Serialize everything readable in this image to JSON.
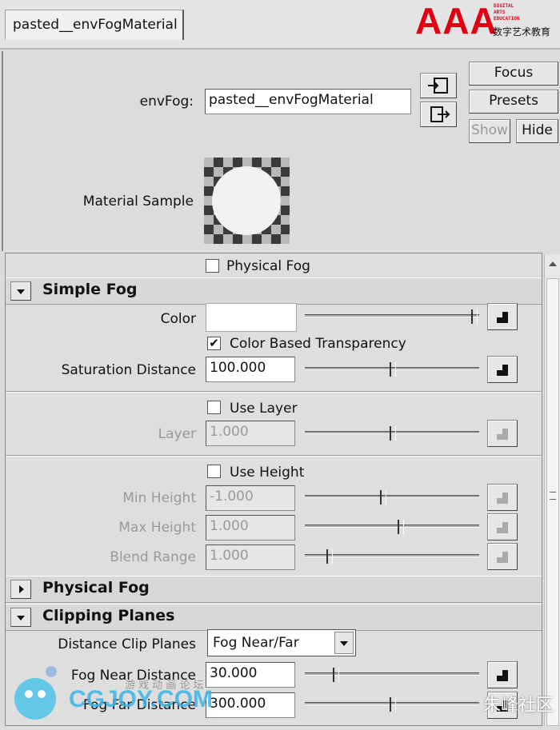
{
  "tab": {
    "label": "pasted__envFogMaterial"
  },
  "logo": {
    "big": "AAA",
    "lines": [
      "DIGITAL",
      "ARTS",
      "EDUCATION"
    ],
    "cn": "数字艺术教育"
  },
  "header": {
    "name_label": "envFog:",
    "name_value": "pasted__envFogMaterial",
    "focus": "Focus",
    "presets": "Presets",
    "show": "Show",
    "hide": "Hide",
    "sample_label": "Material Sample"
  },
  "physical_fog_checkbox": "Physical Fog",
  "simple_fog": {
    "title": "Simple Fog",
    "color_label": "Color",
    "color_transparency": "Color Based Transparency",
    "saturation_label": "Saturation Distance",
    "saturation_value": "100.000",
    "use_layer": "Use Layer",
    "layer_label": "Layer",
    "layer_value": "1.000",
    "use_height": "Use Height",
    "min_height_label": "Min Height",
    "min_height_value": "-1.000",
    "max_height_label": "Max Height",
    "max_height_value": "1.000",
    "blend_label": "Blend Range",
    "blend_value": "1.000"
  },
  "physical_fog": {
    "title": "Physical Fog"
  },
  "clipping": {
    "title": "Clipping Planes",
    "dist_label": "Distance Clip Planes",
    "dist_value": "Fog Near/Far",
    "near_label": "Fog Near Distance",
    "near_value": "30.000",
    "far_label": "Fog Far Distance",
    "far_value": "300.000"
  },
  "watermark": {
    "left": "CGJOY.COM",
    "left_cn": "游 戏 动 画 论 坛",
    "right_cn": "朱峰社区"
  },
  "sliders": {
    "color": 1.0,
    "saturation": 0.51,
    "layer": 0.51,
    "min_height": 0.45,
    "max_height": 0.56,
    "blend": 0.13,
    "near": 0.17,
    "far": 0.51
  }
}
